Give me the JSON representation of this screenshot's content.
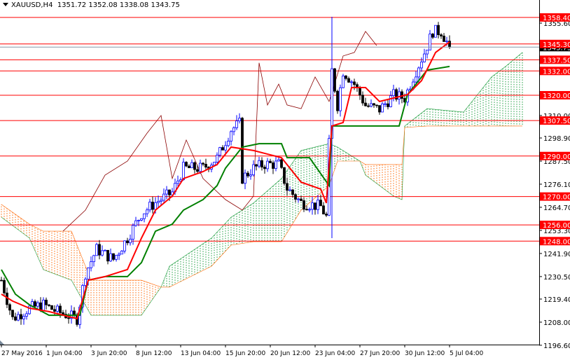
{
  "header": {
    "symbol": "XAUUSD,H4",
    "open": "1351.72",
    "high": "1352.08",
    "low": "1338.08",
    "close": "1343.75"
  },
  "colors": {
    "bull": "#0000ff",
    "bear": "#000000",
    "tenkan": "#ff0000",
    "kijun": "#008000",
    "chikou": "#8b0000",
    "cloud_bull": "#1a9c3c",
    "cloud_bear": "#ff6600",
    "level": "#ff0000",
    "marker": "#0000ff"
  },
  "chart_data": {
    "type": "candlestick",
    "title": "XAUUSD,H4",
    "ylim": [
      1196.6,
      1358.4
    ],
    "y_ticks": [
      "1355.60",
      "1310.00",
      "1298.90",
      "1287.50",
      "1276.10",
      "1264.70",
      "1253.30",
      "1241.90",
      "1230.50",
      "1219.40",
      "1208.00",
      "1196.60"
    ],
    "x_ticks": [
      {
        "bar": 0,
        "label": "27 May 2016"
      },
      {
        "bar": 16,
        "label": "1 Jun 04:00"
      },
      {
        "bar": 32,
        "label": "3 Jun 20:00"
      },
      {
        "bar": 48,
        "label": "8 Jun 12:00"
      },
      {
        "bar": 64,
        "label": "13 Jun 04:00"
      },
      {
        "bar": 80,
        "label": "15 Jun 20:00"
      },
      {
        "bar": 96,
        "label": "20 Jun 12:00"
      },
      {
        "bar": 112,
        "label": "23 Jun 04:00"
      },
      {
        "bar": 128,
        "label": "27 Jun 20:00"
      },
      {
        "bar": 144,
        "label": "30 Jun 12:00"
      },
      {
        "bar": 160,
        "label": "5 Jul 04:00"
      }
    ],
    "levels": [
      "1358.40",
      "1345.30",
      "1337.50",
      "1332.00",
      "1320.00",
      "1307.50",
      "1290.00",
      "1270.00",
      "1256.00",
      "1248.00"
    ],
    "current_price": "1343.75",
    "marker_bar": 118,
    "close_path": [
      [
        0,
        1228.7
      ],
      [
        4,
        1209.7
      ],
      [
        10,
        1214.9
      ],
      [
        15,
        1216.6
      ],
      [
        20,
        1213.2
      ],
      [
        27,
        1209.7
      ],
      [
        30,
        1232.2
      ],
      [
        34,
        1244
      ],
      [
        40,
        1239
      ],
      [
        45,
        1249.5
      ],
      [
        50,
        1261.6
      ],
      [
        55,
        1267
      ],
      [
        61,
        1272
      ],
      [
        65,
        1284
      ],
      [
        72,
        1284
      ],
      [
        77,
        1289
      ],
      [
        82,
        1303
      ],
      [
        85,
        1306
      ],
      [
        86,
        1279
      ],
      [
        90,
        1284
      ],
      [
        94,
        1286
      ],
      [
        99,
        1286
      ],
      [
        102,
        1274
      ],
      [
        107,
        1267
      ],
      [
        114,
        1265
      ],
      [
        116,
        1260
      ],
      [
        118,
        1332
      ],
      [
        120,
        1315
      ],
      [
        122,
        1332
      ],
      [
        126,
        1325.5
      ],
      [
        130,
        1315
      ],
      [
        135,
        1313
      ],
      [
        140,
        1320
      ],
      [
        144,
        1318.6
      ],
      [
        147,
        1329
      ],
      [
        151,
        1341
      ],
      [
        154,
        1351.5
      ],
      [
        157,
        1351.5
      ],
      [
        160,
        1343.75
      ]
    ],
    "tenkan": [
      [
        0,
        1221.8
      ],
      [
        4,
        1218.4
      ],
      [
        10,
        1214.9
      ],
      [
        17,
        1213.2
      ],
      [
        27,
        1209.7
      ],
      [
        31,
        1228.7
      ],
      [
        37,
        1230.5
      ],
      [
        45,
        1234
      ],
      [
        50,
        1249.5
      ],
      [
        55,
        1263.3
      ],
      [
        61,
        1270.2
      ],
      [
        65,
        1278.9
      ],
      [
        72,
        1282.3
      ],
      [
        77,
        1285.8
      ],
      [
        82,
        1294.4
      ],
      [
        90,
        1292.7
      ],
      [
        100,
        1289.2
      ],
      [
        107,
        1277.1
      ],
      [
        114,
        1273.7
      ],
      [
        116,
        1266.8
      ],
      [
        118,
        1304.8
      ],
      [
        122,
        1306.5
      ],
      [
        125,
        1323.8
      ],
      [
        130,
        1323.8
      ],
      [
        135,
        1316.9
      ],
      [
        140,
        1318.6
      ],
      [
        145,
        1320.3
      ],
      [
        150,
        1327.2
      ],
      [
        155,
        1341.1
      ],
      [
        160,
        1346.3
      ]
    ],
    "kijun": [
      [
        0,
        1233.9
      ],
      [
        5,
        1221.8
      ],
      [
        10,
        1216.6
      ],
      [
        17,
        1211.4
      ],
      [
        28,
        1211.4
      ],
      [
        31,
        1228.7
      ],
      [
        37,
        1230.5
      ],
      [
        45,
        1230.5
      ],
      [
        50,
        1237.4
      ],
      [
        55,
        1252.9
      ],
      [
        61,
        1256.4
      ],
      [
        65,
        1263.3
      ],
      [
        72,
        1268.5
      ],
      [
        77,
        1275.4
      ],
      [
        80,
        1284
      ],
      [
        86,
        1294.4
      ],
      [
        92,
        1296.1
      ],
      [
        100,
        1296.1
      ],
      [
        102,
        1289.2
      ],
      [
        110,
        1289.2
      ],
      [
        117,
        1275.4
      ],
      [
        118,
        1304.8
      ],
      [
        142,
        1304.8
      ],
      [
        145,
        1320.3
      ],
      [
        152,
        1332.4
      ],
      [
        160,
        1334.2
      ]
    ],
    "chikou": [
      [
        22,
        1252.9
      ],
      [
        30,
        1263.3
      ],
      [
        37,
        1280.6
      ],
      [
        45,
        1287.5
      ],
      [
        52,
        1301.3
      ],
      [
        57,
        1310
      ],
      [
        61,
        1278.9
      ],
      [
        66,
        1297.9
      ],
      [
        72,
        1278.9
      ],
      [
        80,
        1268.5
      ],
      [
        86,
        1263.3
      ],
      [
        90,
        1270.2
      ],
      [
        92,
        1336
      ],
      [
        95,
        1315.2
      ],
      [
        99,
        1325.5
      ],
      [
        102,
        1315.2
      ],
      [
        107,
        1313.4
      ],
      [
        112,
        1329
      ],
      [
        117,
        1316.9
      ],
      [
        122,
        1339.4
      ],
      [
        126,
        1341.1
      ],
      [
        130,
        1351.5
      ],
      [
        134,
        1344.5
      ]
    ],
    "cloud": [
      [
        0,
        1259.8,
        1266.1
      ],
      [
        10,
        1249.5,
        1256.4
      ],
      [
        15,
        1233.9,
        1252.9
      ],
      [
        25,
        1228.7,
        1252.9
      ],
      [
        32,
        1211.4,
        1228.7
      ],
      [
        50,
        1211.4,
        1228.7
      ],
      [
        57,
        1225.3,
        1225.3
      ],
      [
        60,
        1235.6,
        1225.3
      ],
      [
        75,
        1249.5,
        1235.6
      ],
      [
        82,
        1259.8,
        1246
      ],
      [
        90,
        1266.8,
        1247.7
      ],
      [
        100,
        1278.9,
        1247.7
      ],
      [
        107,
        1292.7,
        1263.3
      ],
      [
        117,
        1296.1,
        1275.4
      ],
      [
        120,
        1294.4,
        1287.5
      ],
      [
        128,
        1287.5,
        1287.5
      ],
      [
        130,
        1280.6,
        1285.8
      ],
      [
        140,
        1270.2,
        1285.8
      ],
      [
        143,
        1268.5,
        1285.8
      ],
      [
        144,
        1304.8,
        1304.1
      ],
      [
        152,
        1313.4,
        1304.8
      ],
      [
        165,
        1311.7,
        1304.8
      ],
      [
        175,
        1329,
        1304.8
      ],
      [
        180,
        1334.2,
        1304.8
      ],
      [
        186,
        1341.1,
        1304.8
      ]
    ]
  }
}
